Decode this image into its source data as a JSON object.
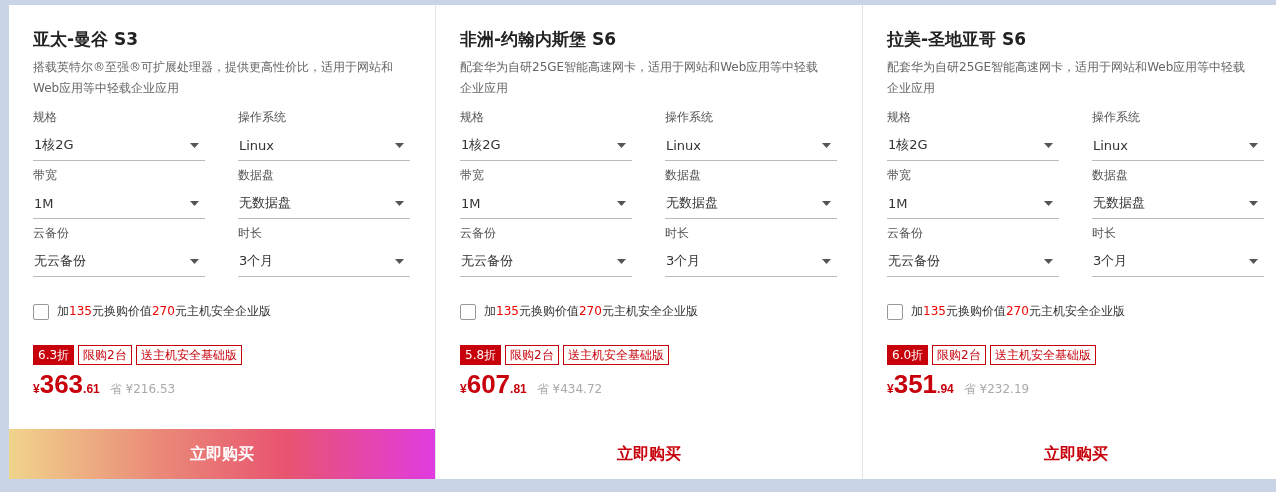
{
  "cards": [
    {
      "title": "亚太-曼谷 S3",
      "description": "搭载英特尔®至强®可扩展处理器，提供更高性价比，适用于网站和Web应用等中轻载企业应用",
      "selected": true,
      "fields": [
        {
          "label": "规格",
          "value": "1核2G"
        },
        {
          "label": "操作系统",
          "value": "Linux"
        },
        {
          "label": "带宽",
          "value": "1M"
        },
        {
          "label": "数据盘",
          "value": "无数据盘"
        },
        {
          "label": "云备份",
          "value": "无云备份"
        },
        {
          "label": "时长",
          "value": "3个月"
        }
      ],
      "addon": {
        "checked": false,
        "parts": [
          {
            "text": "加",
            "highlight": false
          },
          {
            "text": "135",
            "highlight": true
          },
          {
            "text": "元换购价值",
            "highlight": false
          },
          {
            "text": "270",
            "highlight": true
          },
          {
            "text": "元主机安全企业版",
            "highlight": false
          }
        ]
      },
      "tags": [
        {
          "kind": "discount",
          "text": "6.3折"
        },
        {
          "kind": "outline",
          "text": "限购2台"
        },
        {
          "kind": "outline",
          "text": "送主机安全基础版"
        }
      ],
      "price": {
        "currency": "¥",
        "integer": "363",
        "decimal": ".61",
        "saving": "省 ¥216.53"
      },
      "button": "立即购买"
    },
    {
      "title": "非洲-约翰内斯堡 S6",
      "description": "配套华为自研25GE智能高速网卡，适用于网站和Web应用等中轻载企业应用",
      "selected": false,
      "fields": [
        {
          "label": "规格",
          "value": "1核2G"
        },
        {
          "label": "操作系统",
          "value": "Linux"
        },
        {
          "label": "带宽",
          "value": "1M"
        },
        {
          "label": "数据盘",
          "value": "无数据盘"
        },
        {
          "label": "云备份",
          "value": "无云备份"
        },
        {
          "label": "时长",
          "value": "3个月"
        }
      ],
      "addon": {
        "checked": false,
        "parts": [
          {
            "text": "加",
            "highlight": false
          },
          {
            "text": "135",
            "highlight": true
          },
          {
            "text": "元换购价值",
            "highlight": false
          },
          {
            "text": "270",
            "highlight": true
          },
          {
            "text": "元主机安全企业版",
            "highlight": false
          }
        ]
      },
      "tags": [
        {
          "kind": "discount",
          "text": "5.8折"
        },
        {
          "kind": "outline",
          "text": "限购2台"
        },
        {
          "kind": "outline",
          "text": "送主机安全基础版"
        }
      ],
      "price": {
        "currency": "¥",
        "integer": "607",
        "decimal": ".81",
        "saving": "省 ¥434.72"
      },
      "button": "立即购买"
    },
    {
      "title": "拉美-圣地亚哥 S6",
      "description": "配套华为自研25GE智能高速网卡，适用于网站和Web应用等中轻载企业应用",
      "selected": false,
      "fields": [
        {
          "label": "规格",
          "value": "1核2G"
        },
        {
          "label": "操作系统",
          "value": "Linux"
        },
        {
          "label": "带宽",
          "value": "1M"
        },
        {
          "label": "数据盘",
          "value": "无数据盘"
        },
        {
          "label": "云备份",
          "value": "无云备份"
        },
        {
          "label": "时长",
          "value": "3个月"
        }
      ],
      "addon": {
        "checked": false,
        "parts": [
          {
            "text": "加",
            "highlight": false
          },
          {
            "text": "135",
            "highlight": true
          },
          {
            "text": "元换购价值",
            "highlight": false
          },
          {
            "text": "270",
            "highlight": true
          },
          {
            "text": "元主机安全企业版",
            "highlight": false
          }
        ]
      },
      "tags": [
        {
          "kind": "discount",
          "text": "6.0折"
        },
        {
          "kind": "outline",
          "text": "限购2台"
        },
        {
          "kind": "outline",
          "text": "送主机安全基础版"
        }
      ],
      "price": {
        "currency": "¥",
        "integer": "351",
        "decimal": ".94",
        "saving": "省 ¥232.19"
      },
      "button": "立即购买"
    }
  ]
}
